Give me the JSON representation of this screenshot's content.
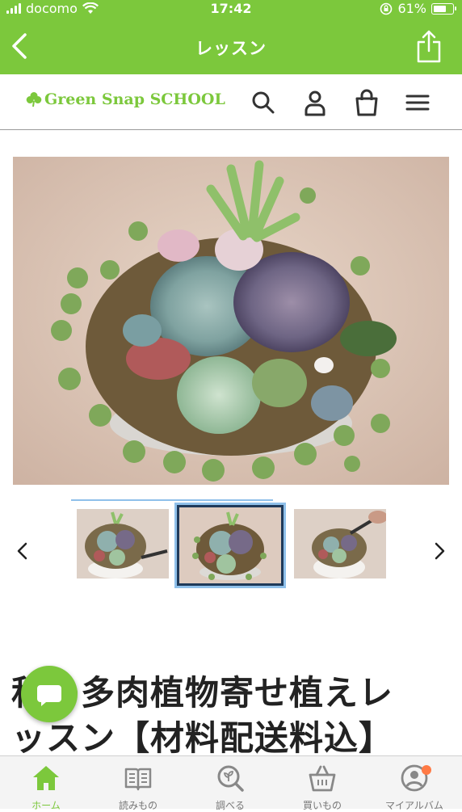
{
  "status_bar": {
    "carrier": "docomo",
    "time": "17:42",
    "battery": "61%"
  },
  "nav": {
    "title": "レッスン"
  },
  "header": {
    "logo_text": "Green Snap SCHOOL"
  },
  "lesson": {
    "title_line1": "秋の多肉植物寄せ植えレ",
    "title_line2": "ッスン【材料配送料込】"
  },
  "tabs": [
    {
      "label": "ホーム",
      "icon": "home-icon",
      "active": true
    },
    {
      "label": "読みもの",
      "icon": "book-icon"
    },
    {
      "label": "調べる",
      "icon": "search-plant-icon"
    },
    {
      "label": "買いもの",
      "icon": "basket-icon"
    },
    {
      "label": "マイアルバム",
      "icon": "profile-icon"
    }
  ],
  "colors": {
    "brand_green": "#7cc83c",
    "selected_thumb_border": "#8fc0ea",
    "notification_dot": "#ff7a45"
  }
}
